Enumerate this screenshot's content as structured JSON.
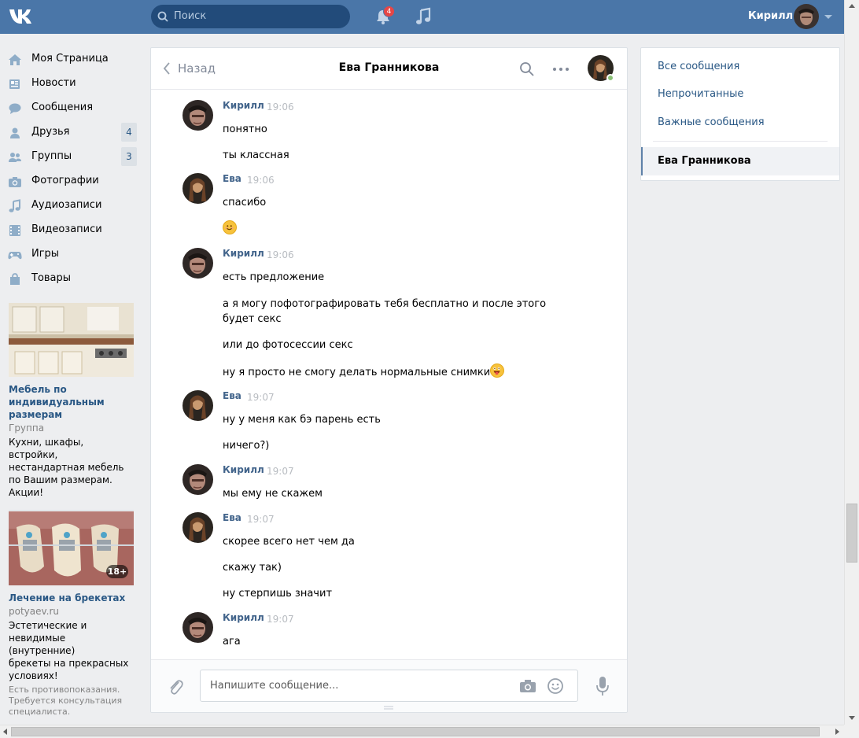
{
  "header": {
    "search_placeholder": "Поиск",
    "notifications_count": "4",
    "user_name": "Кирилл"
  },
  "leftnav": {
    "items": [
      {
        "label": "Моя Страница",
        "icon": "home-icon"
      },
      {
        "label": "Новости",
        "icon": "news-icon"
      },
      {
        "label": "Сообщения",
        "icon": "messages-icon"
      },
      {
        "label": "Друзья",
        "icon": "friends-icon",
        "count": "4"
      },
      {
        "label": "Группы",
        "icon": "groups-icon",
        "count": "3"
      },
      {
        "label": "Фотографии",
        "icon": "camera-icon"
      },
      {
        "label": "Аудиозаписи",
        "icon": "music-icon"
      },
      {
        "label": "Видеозаписи",
        "icon": "video-icon"
      },
      {
        "label": "Игры",
        "icon": "gamepad-icon"
      },
      {
        "label": "Товары",
        "icon": "bag-icon"
      }
    ]
  },
  "ads": [
    {
      "title_lines": [
        "Мебель по",
        "индивидуальным",
        "размерам"
      ],
      "subtitle": "Группа",
      "desc_lines": [
        "Кухни, шкафы, встройки,",
        "нестандартная мебель",
        "по Вашим размерам.",
        "Акции!"
      ]
    },
    {
      "title_lines": [
        "Лечение на брекетах"
      ],
      "subtitle": "potyaev.ru",
      "age_badge": "18+",
      "desc_lines": [
        "Эстетические и",
        "невидимые (внутренние)",
        "брекеты на прекрасных",
        "условиях!"
      ],
      "note_lines": [
        "Есть противопоказания.",
        "Требуется консультация",
        "специалиста."
      ]
    }
  ],
  "chat": {
    "back_label": "Назад",
    "title": "Ева Гранникова",
    "input_placeholder": "Напишите сообщение...",
    "groups": [
      {
        "author": "Кирилл",
        "time": "19:06",
        "who": "k",
        "messages": [
          "понятно",
          "ты классная"
        ]
      },
      {
        "author": "Ева",
        "time": "19:06",
        "who": "e",
        "messages": [
          "спасибо",
          ""
        ]
      },
      {
        "author": "Кирилл",
        "time": "19:06",
        "who": "k",
        "messages": [
          "есть предложение",
          "а я могу пофотографировать тебя бесплатно и после этого",
          "будет секс",
          "или до фотосессии секс",
          "ну я просто не смогу делать нормальные снимки"
        ]
      },
      {
        "author": "Ева",
        "time": "19:07",
        "who": "e",
        "messages": [
          "ну у меня как бэ парень есть",
          "ничего?)"
        ]
      },
      {
        "author": "Кирилл",
        "time": "19:07",
        "who": "k",
        "messages": [
          "мы ему не скажем"
        ]
      },
      {
        "author": "Ева",
        "time": "19:07",
        "who": "e",
        "messages": [
          "скорее всего нет чем да",
          "скажу так)",
          "ну стерпишь значит"
        ]
      },
      {
        "author": "Кирилл",
        "time": "19:07",
        "who": "k",
        "messages": [
          "ага"
        ]
      }
    ]
  },
  "rightmenu": {
    "all": "Все сообщения",
    "unread": "Непрочитанные",
    "important": "Важные сообщения",
    "active_chat": "Ева Гранникова"
  }
}
